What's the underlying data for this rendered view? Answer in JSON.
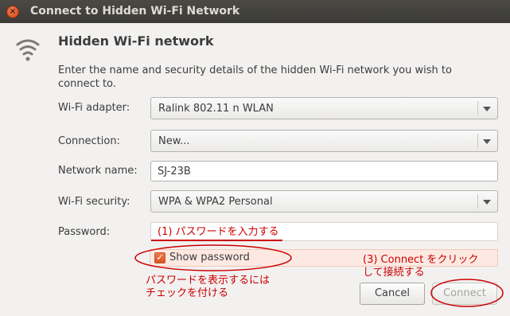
{
  "window": {
    "title": "Connect to Hidden Wi-Fi Network",
    "close_glyph": "×"
  },
  "header": {
    "icon": "wifi-icon",
    "heading": "Hidden Wi-Fi network",
    "description": "Enter the name and security details of the hidden Wi-Fi network you wish to connect to."
  },
  "form": {
    "adapter": {
      "label": "Wi-Fi adapter:",
      "value": "Ralink 802.11 n WLAN"
    },
    "connection": {
      "label": "Connection:",
      "value": "New..."
    },
    "network_name": {
      "label": "Network name:",
      "value": "SJ-23B"
    },
    "security": {
      "label": "Wi-Fi security:",
      "value": "WPA & WPA2 Personal"
    },
    "password": {
      "label": "Password:",
      "value": "(1) パスワードを入力する"
    },
    "show_password": {
      "label": "Show password",
      "checked": true,
      "check_glyph": "✓"
    }
  },
  "annotations": {
    "show_password_note_line1": "パスワードを表示するには",
    "show_password_note_line2": "チェックを付ける",
    "connect_note_line1": "(3) Connect をクリック",
    "connect_note_line2": "して接続する",
    "color": "#cc0000"
  },
  "buttons": {
    "cancel": "Cancel",
    "connect": "Connect"
  },
  "colors": {
    "titlebar": "#3c3b37",
    "accent": "#dd4814",
    "background": "#f2f1f0"
  }
}
